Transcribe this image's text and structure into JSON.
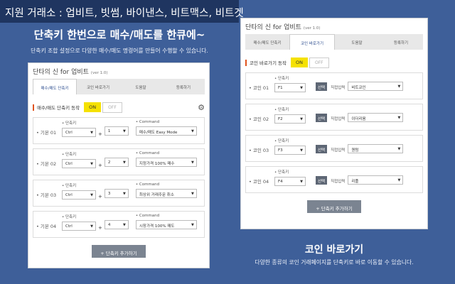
{
  "banner": {
    "top": "지원 거래소 : 업비트, 빗썸, 바이낸스, 비트맥스, 비트겟",
    "headline": "단축키 한번으로 매수/매도를 한큐에~",
    "subline": "단축키 조합 설정으로 다양한 매수/매도 명령어를 만들어 수행할 수 있습니다.",
    "bottom_title": "코인 바로가기",
    "bottom_desc": "다양한 종류의 코인 거래페이지를 단축키로 바로 이동할 수 있습니다."
  },
  "left_panel": {
    "title": "단타의 신 for 업비트",
    "version": "(ver 1.0)",
    "tabs": [
      "매수/매도 단축키",
      "코인 바로가기",
      "도움말",
      "등록하기"
    ],
    "toggle_label": "매수/매도 단축키 동작",
    "on": "ON",
    "off": "OFF",
    "col_shortcut": "• 단축키",
    "col_command": "• Command",
    "rows": [
      {
        "name": "• 기본 01",
        "mod": "Ctrl",
        "key": "1",
        "command": "매수/매도 Easy Mode"
      },
      {
        "name": "• 기본 02",
        "mod": "Ctrl",
        "key": "2",
        "command": "지정가격 100% 매수"
      },
      {
        "name": "• 기본 03",
        "mod": "Ctrl",
        "key": "3",
        "command": "최상위 거래주문 취소"
      },
      {
        "name": "• 기본 04",
        "mod": "Ctrl",
        "key": "4",
        "command": "시장가격 100% 매도"
      }
    ],
    "add_button": "+ 단축키 추가하기"
  },
  "right_panel": {
    "title": "단타의 신 for 업비트",
    "version": "(ver 1.0)",
    "tabs": [
      "매수/매도 단축키",
      "코인 바로가기",
      "도움말",
      "등록하기"
    ],
    "toggle_label": "코인 바로가기 동작",
    "on": "ON",
    "off": "OFF",
    "col_shortcut": "• 단축키",
    "pick": "선택",
    "direct": "직접입력",
    "rows": [
      {
        "name": "• 코인 01",
        "key": "F1",
        "coin": "비트코인"
      },
      {
        "name": "• 코인 02",
        "key": "F2",
        "coin": "이더리움"
      },
      {
        "name": "• 코인 03",
        "key": "F3",
        "coin": "퀀텀"
      },
      {
        "name": "• 코인 04",
        "key": "F4",
        "coin": "리플"
      }
    ],
    "add_button": "+ 단축키 추가하기"
  }
}
